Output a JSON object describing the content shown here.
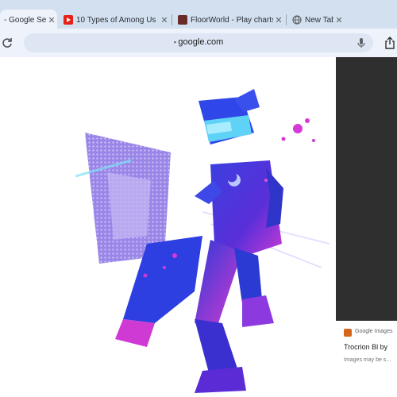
{
  "browser": {
    "tabs": [
      {
        "title": "- Google Se",
        "active": true,
        "favicon": "google-favicon"
      },
      {
        "title": "10 Types of Among Us",
        "active": false,
        "favicon": "youtube-favicon"
      },
      {
        "title": "FloorWorld - Play charts",
        "active": false,
        "favicon": "site-favicon"
      },
      {
        "title": "New Tab",
        "active": false,
        "favicon": "new-tab-favicon"
      }
    ],
    "url": "google.com"
  },
  "result": {
    "source": "Google Images",
    "title": "Trocrion Bl by ",
    "note": "Images may be s..."
  },
  "colors": {
    "tabbar_bg": "#d3e0ef",
    "toolbar_bg": "#eef3fb",
    "omnibox_bg": "#dde6f2",
    "side_panel_bg": "#2f2f2f",
    "art_blue": "#3a3bd8",
    "art_magenta": "#d63ad6",
    "art_cyan": "#34c8ef"
  }
}
